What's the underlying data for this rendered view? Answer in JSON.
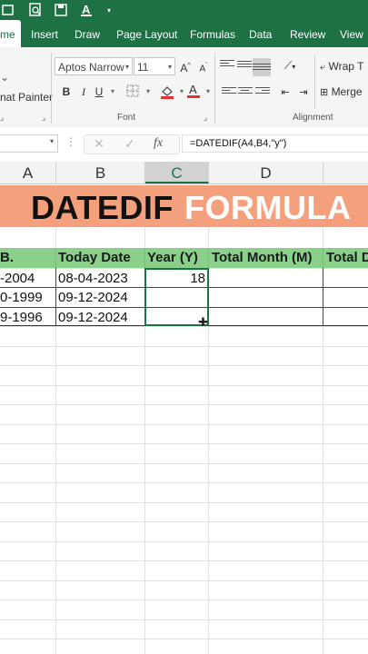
{
  "ribbon_tabs": [
    "me",
    "Insert",
    "Draw",
    "Page Layout",
    "Formulas",
    "Data",
    "Review",
    "View"
  ],
  "font_name": "Aptos Narrow",
  "font_size": "11",
  "wrap_text": "Wrap T",
  "merge": "Merge",
  "format_painter": "nat Painter",
  "group_font": "Font",
  "group_alignment": "Alignment",
  "formula": "=DATEDIF(A4,B4,\"y\")",
  "fx": "fx",
  "columns": [
    "A",
    "B",
    "C",
    "D"
  ],
  "banner": {
    "part1": "DATEDIF",
    "part2": "FORMULA"
  },
  "table": {
    "headers": [
      "B.",
      "Today Date",
      "Year (Y)",
      "Total Month (M)",
      "Total D"
    ],
    "rows": [
      [
        "-2004",
        "08-04-2023",
        "18"
      ],
      [
        "0-1999",
        "09-12-2024",
        ""
      ],
      [
        "9-1996",
        "09-12-2024",
        ""
      ]
    ]
  },
  "colors": {
    "excel_green": "#1e7145",
    "banner_bg": "#f4a07c",
    "header_green": "#8ad08a"
  }
}
